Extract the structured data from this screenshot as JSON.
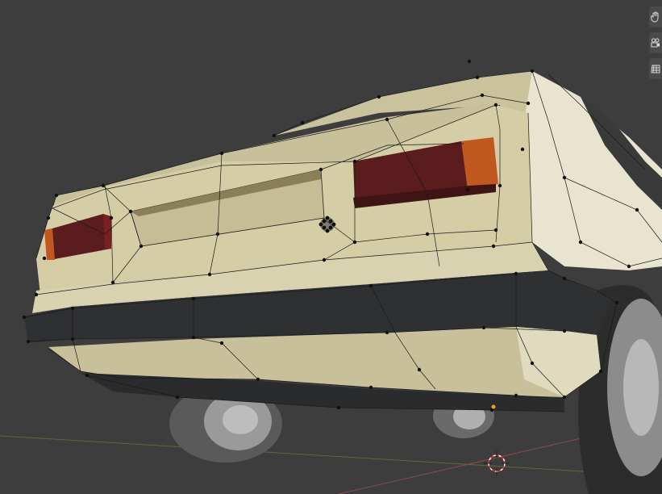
{
  "viewport": {
    "background": "#3d3d3d",
    "grid_axis_x_color": "#8a4a4a",
    "grid_axis_y_color": "#6b7a4a"
  },
  "model": {
    "body_color": "#d6cfa8",
    "body_shade": "#b9b088",
    "bumper_color": "#2f3032",
    "taillight_color": "#5a1c1c",
    "indicator_color": "#c0581f",
    "wheel_color": "#8a8a8a"
  },
  "gizmos": {
    "pan": "hand-pan-icon",
    "camera": "camera-view-icon",
    "ortho": "grid-ortho-icon"
  }
}
